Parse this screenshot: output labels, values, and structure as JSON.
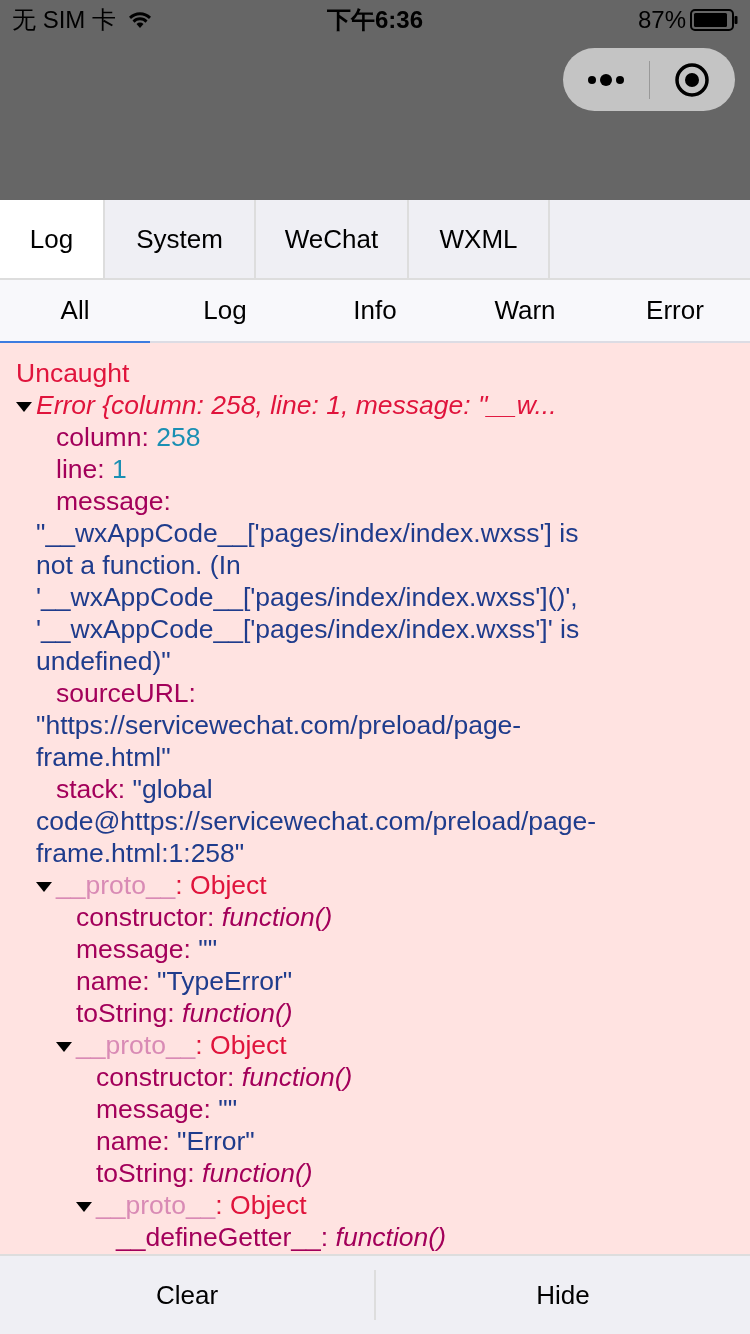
{
  "status_bar": {
    "carrier": "无 SIM 卡",
    "time": "下午6:36",
    "battery": "87%"
  },
  "tabs": [
    {
      "label": "Log",
      "selected": true
    },
    {
      "label": "System",
      "selected": false
    },
    {
      "label": "WeChat",
      "selected": false
    },
    {
      "label": "WXML",
      "selected": false
    }
  ],
  "filters": [
    {
      "label": "All",
      "selected": true
    },
    {
      "label": "Log",
      "selected": false
    },
    {
      "label": "Info",
      "selected": false
    },
    {
      "label": "Warn",
      "selected": false
    },
    {
      "label": "Error",
      "selected": false
    }
  ],
  "console": {
    "header": "Uncaught",
    "tree": {
      "kind": "summary",
      "label": "Error {column: 258, line: 1, message: \"__w...",
      "expanded": true,
      "children": [
        {
          "kind": "number",
          "key": "column:",
          "value": "258"
        },
        {
          "kind": "number",
          "key": "line:",
          "value": "1"
        },
        {
          "kind": "string",
          "key": "message:",
          "value": "\"__wxAppCode__['pages/index/index.wxss'] is not a function. (In '__wxAppCode__['pages/index/index.wxss']()', '__wxAppCode__['pages/index/index.wxss']' is undefined)\""
        },
        {
          "kind": "string",
          "key": "sourceURL:",
          "value": "\"https://servicewechat.com/preload/page-frame.html\""
        },
        {
          "kind": "string",
          "key": "stack:",
          "value": "\"global code@https://servicewechat.com/preload/page-frame.html:1:258\""
        },
        {
          "kind": "object",
          "key": "__proto__",
          "value": ": Object",
          "expanded": true,
          "children": [
            {
              "kind": "function",
              "key": "constructor:",
              "value": "function()"
            },
            {
              "kind": "string",
              "key": "message:",
              "value": "\"\""
            },
            {
              "kind": "string",
              "key": "name:",
              "value": "\"TypeError\""
            },
            {
              "kind": "function",
              "key": "toString:",
              "value": "function()"
            },
            {
              "kind": "object",
              "key": "__proto__",
              "value": ": Object",
              "expanded": true,
              "children": [
                {
                  "kind": "function",
                  "key": "constructor:",
                  "value": "function()"
                },
                {
                  "kind": "string",
                  "key": "message:",
                  "value": "\"\""
                },
                {
                  "kind": "string",
                  "key": "name:",
                  "value": "\"Error\""
                },
                {
                  "kind": "function",
                  "key": "toString:",
                  "value": "function()"
                },
                {
                  "kind": "object",
                  "key": "__proto__",
                  "value": ": Object",
                  "expanded": true,
                  "children": [
                    {
                      "kind": "function",
                      "key": "__defineGetter__:",
                      "value": "function()"
                    }
                  ]
                }
              ]
            }
          ]
        }
      ]
    }
  },
  "buttons": [
    "Clear",
    "Hide"
  ]
}
